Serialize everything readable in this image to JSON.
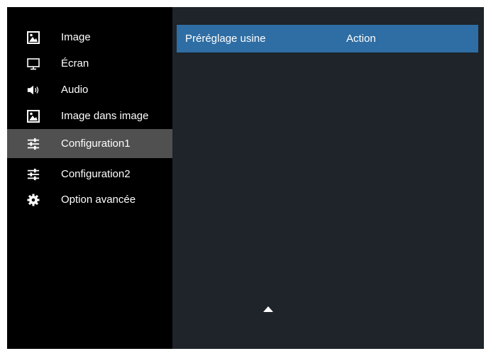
{
  "sidebar": {
    "items": [
      {
        "label": "Image",
        "icon": "picture-icon"
      },
      {
        "label": "Écran",
        "icon": "monitor-icon"
      },
      {
        "label": "Audio",
        "icon": "speaker-icon"
      },
      {
        "label": "Image dans image",
        "icon": "picture-in-picture-icon"
      },
      {
        "label": "Configuration1",
        "icon": "sliders-icon",
        "selected": true
      },
      {
        "label": "Configuration2",
        "icon": "sliders-icon"
      },
      {
        "label": "Option avancée",
        "icon": "gear-icon"
      }
    ]
  },
  "content": {
    "row": {
      "name": "Préréglage usine",
      "value": "Action"
    }
  },
  "colors": {
    "sidebar_bg": "#000000",
    "selected_bg": "#505050",
    "content_bg": "#1e242a",
    "highlight_row": "#2f6ea4",
    "text": "#ffffff"
  }
}
